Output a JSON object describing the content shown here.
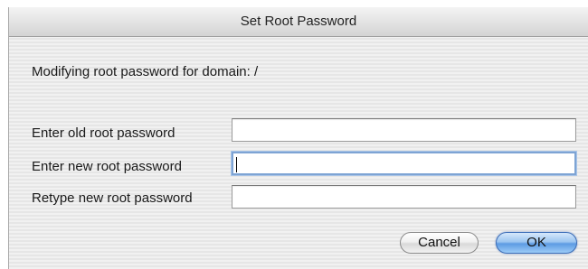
{
  "window": {
    "title": "Set Root Password"
  },
  "message": "Modifying root password for domain: /",
  "fields": [
    {
      "label": "Enter old root password",
      "value": ""
    },
    {
      "label": "Enter new root password",
      "value": ""
    },
    {
      "label": "Retype new root password",
      "value": ""
    }
  ],
  "buttons": {
    "cancel_label": "Cancel",
    "ok_label": "OK"
  },
  "colors": {
    "default_button": "#5d9be3",
    "focus_ring": "#7ea4d4"
  }
}
